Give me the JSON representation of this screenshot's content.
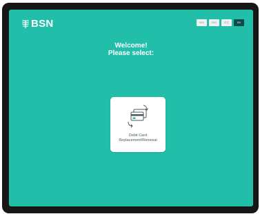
{
  "brand": {
    "name": "BSN",
    "icon": "palm-leaf-icon"
  },
  "languages": [
    {
      "code": "MYS",
      "active": false
    },
    {
      "code": "ENG",
      "active": false
    },
    {
      "code": "中文",
      "active": false
    },
    {
      "code": "EN",
      "active": true
    }
  ],
  "welcome": {
    "line1": "Welcome!",
    "line2": "Please select:"
  },
  "options": [
    {
      "line1": "Debit Card",
      "line2": "Replacement/Renewal",
      "icon": "debit-card-replacement-icon"
    }
  ],
  "colors": {
    "screen": "#21bfaa",
    "bezel": "#161616",
    "active_lang": "#0f4a4a"
  }
}
